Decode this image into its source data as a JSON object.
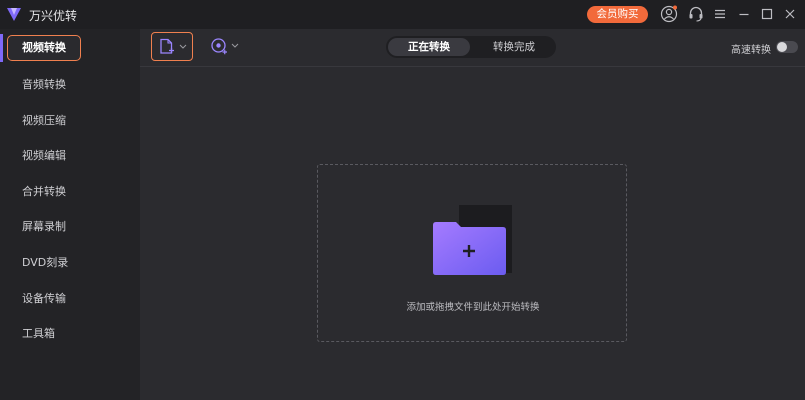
{
  "titlebar": {
    "app_name": "万兴优转",
    "vip_button": "会员购买",
    "icons": [
      "account-icon",
      "support-icon",
      "menu-icon",
      "minimize-icon",
      "maximize-icon",
      "close-icon"
    ]
  },
  "sidebar": {
    "items": [
      {
        "label": "视频转换",
        "active": true
      },
      {
        "label": "音频转换"
      },
      {
        "label": "视频压缩"
      },
      {
        "label": "视频编辑"
      },
      {
        "label": "合并转换"
      },
      {
        "label": "屏幕录制"
      },
      {
        "label": "DVD刻录"
      },
      {
        "label": "设备传输"
      },
      {
        "label": "工具箱"
      }
    ]
  },
  "toolbar": {
    "tabs": [
      {
        "label": "正在转换",
        "selected": true
      },
      {
        "label": "转换完成"
      }
    ],
    "high_speed_label": "高速转换",
    "high_speed_on": false
  },
  "dropzone": {
    "hint": "添加或拖拽文件到此处开始转换"
  },
  "colors": {
    "accent_orange": "#f0804f",
    "vip_orange": "#f26a3b",
    "purple": "#7f69f7"
  }
}
